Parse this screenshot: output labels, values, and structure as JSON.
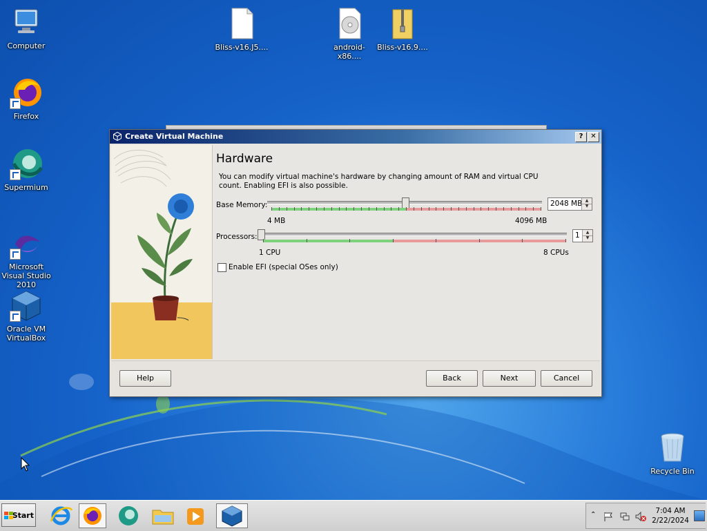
{
  "desktop": {
    "icons": [
      {
        "label": "Computer"
      },
      {
        "label": "Firefox"
      },
      {
        "label": "Supermium"
      },
      {
        "label": "Microsoft Visual Studio 2010"
      },
      {
        "label": "Oracle VM VirtualBox"
      },
      {
        "label": "Bliss-v16.J5...."
      },
      {
        "label": "android-x86...."
      },
      {
        "label": "Bliss-v16.9...."
      },
      {
        "label": "Recycle Bin"
      }
    ]
  },
  "dialog": {
    "title": "Create Virtual Machine",
    "help_glyph": "?",
    "close_glyph": "✕",
    "heading": "Hardware",
    "description": "You can modify virtual machine's hardware by changing amount of RAM and virtual CPU count. Enabling EFI is also possible.",
    "memory": {
      "label": "Base Memory:",
      "value": "2048 MB",
      "min_label": "4 MB",
      "max_label": "4096 MB",
      "fraction": 0.5
    },
    "processors": {
      "label": "Processors:",
      "value": "1",
      "min_label": "1 CPU",
      "max_label": "8 CPUs",
      "fraction": 0.0
    },
    "efi": {
      "label": "Enable EFI (special OSes only)",
      "checked": false
    },
    "buttons": {
      "help": "Help",
      "back": "Back",
      "next": "Next",
      "cancel": "Cancel"
    }
  },
  "taskbar": {
    "start_label": "Start",
    "apps": [
      "internet-explorer",
      "firefox",
      "supermium",
      "file-explorer",
      "media-player",
      "virtualbox"
    ],
    "clock": {
      "time": "7:04 AM",
      "date": "2/22/2024"
    }
  },
  "colors": {
    "title_gradient_start": "#0a246a",
    "slider_green": "#7ed27e",
    "slider_red": "#e89a9a"
  }
}
